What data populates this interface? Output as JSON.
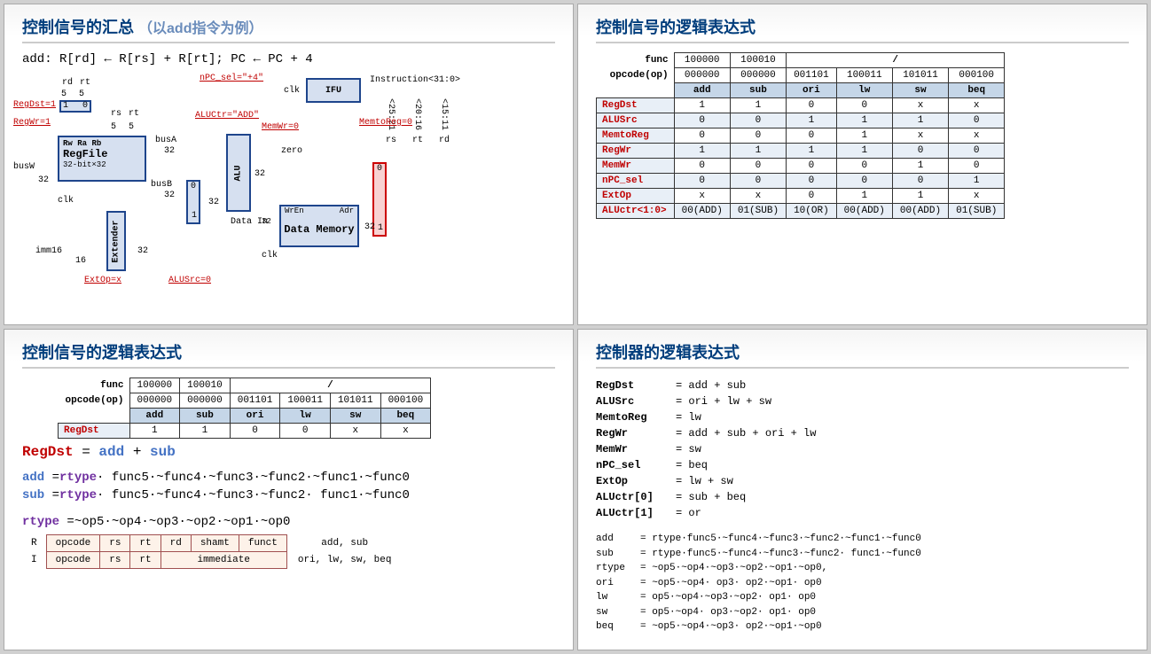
{
  "slides": {
    "tl": {
      "title": "控制信号的汇总",
      "subtitle": "（以add指令为例）",
      "formula": "add: R[rd] ← R[rs] + R[rt]; PC ← PC + 4",
      "diagram": {
        "ifu": "IFU",
        "regfile": "RegFile",
        "regfile_sub": "32-bit×32",
        "alu": "ALU",
        "datamem": "Data Memory",
        "extender": "Extender",
        "instruction": "Instruction<31:0>",
        "rd": "rd",
        "rt": "rt",
        "rs": "rs",
        "rw": "Rw",
        "ra": "Ra",
        "rb": "Rb",
        "clk": "clk",
        "busW": "busW",
        "busA": "busA",
        "busB": "busB",
        "imm16": "imm16",
        "zero": "zero",
        "wren": "WrEn",
        "adr": "Adr",
        "datain": "Data In",
        "regdst": "RegDst=1",
        "regwr": "RegWr=1",
        "npcsel": "nPC_sel=\"+4\"",
        "aluctr": "ALUCtr=\"ADD\"",
        "memwr": "MemWr=0",
        "memtoreg": "MemtoReg=0",
        "extop": "ExtOp=x",
        "alusrc": "ALUSrc=0",
        "n32": "32",
        "n16": "16",
        "n5": "5",
        "m0": "0",
        "m1": "1",
        "sl2521": "<25:21",
        "sl2016": "<20:16",
        "sl1511": "<15:11"
      }
    },
    "tr": {
      "title": "控制信号的逻辑表达式",
      "table": {
        "h_func": "func",
        "h_opcode": "opcode(op)",
        "func_vals": [
          "100000",
          "100010",
          "/",
          "",
          "",
          ""
        ],
        "op_vals": [
          "000000",
          "000000",
          "001101",
          "100011",
          "101011",
          "000100"
        ],
        "cols": [
          "add",
          "sub",
          "ori",
          "lw",
          "sw",
          "beq"
        ],
        "rows": [
          {
            "label": "RegDst",
            "vals": [
              "1",
              "1",
              "0",
              "0",
              "x",
              "x"
            ]
          },
          {
            "label": "ALUSrc",
            "vals": [
              "0",
              "0",
              "1",
              "1",
              "1",
              "0"
            ]
          },
          {
            "label": "MemtoReg",
            "vals": [
              "0",
              "0",
              "0",
              "1",
              "x",
              "x"
            ]
          },
          {
            "label": "RegWr",
            "vals": [
              "1",
              "1",
              "1",
              "1",
              "0",
              "0"
            ]
          },
          {
            "label": "MemWr",
            "vals": [
              "0",
              "0",
              "0",
              "0",
              "1",
              "0"
            ]
          },
          {
            "label": "nPC_sel",
            "vals": [
              "0",
              "0",
              "0",
              "0",
              "0",
              "1"
            ]
          },
          {
            "label": "ExtOp",
            "vals": [
              "x",
              "x",
              "0",
              "1",
              "1",
              "x"
            ]
          },
          {
            "label": "ALUctr<1:0>",
            "vals": [
              "00(ADD)",
              "01(SUB)",
              "10(OR)",
              "00(ADD)",
              "00(ADD)",
              "01(SUB)"
            ]
          }
        ]
      }
    },
    "bl": {
      "title": "控制信号的逻辑表达式",
      "table": {
        "h_func": "func",
        "h_opcode": "opcode(op)",
        "func_vals": [
          "100000",
          "100010",
          "/",
          "",
          "",
          ""
        ],
        "op_vals": [
          "000000",
          "000000",
          "001101",
          "100011",
          "101011",
          "000100"
        ],
        "cols": [
          "add",
          "sub",
          "ori",
          "lw",
          "sw",
          "beq"
        ],
        "row": {
          "label": "RegDst",
          "vals": [
            "1",
            "1",
            "0",
            "0",
            "x",
            "x"
          ]
        }
      },
      "eq1_lhs": "RegDst",
      "eq1_eq": " = ",
      "eq1_a": "add",
      "eq1_plus": " + ",
      "eq1_b": "sub",
      "eq_add_l": "add",
      "eq_add_r": "rtype",
      "eq_add_rest": "· func5·~func4·~func3·~func2·~func1·~func0",
      "eq_sub_l": "sub",
      "eq_sub_r": "rtype",
      "eq_sub_rest": "· func5·~func4·~func3·~func2· func1·~func0",
      "eq_rtype_l": "rtype",
      "eq_rtype_rest": " =~op5·~op4·~op3·~op2·~op1·~op0",
      "rfmt": {
        "r": "R",
        "i": "I",
        "fields": [
          "opcode",
          "rs",
          "rt",
          "rd",
          "shamt",
          "funct"
        ],
        "ifields": [
          "opcode",
          "rs",
          "rt",
          "immediate"
        ],
        "rnote": "add, sub",
        "inote": "ori, lw, sw, beq"
      }
    },
    "br": {
      "title": "控制器的逻辑表达式",
      "eqs": [
        {
          "lhs": "RegDst",
          "rhs": "= add + sub"
        },
        {
          "lhs": "ALUSrc",
          "rhs": "= ori + lw + sw"
        },
        {
          "lhs": "MemtoReg",
          "rhs": "= lw"
        },
        {
          "lhs": "RegWr",
          "rhs": "= add + sub + ori + lw"
        },
        {
          "lhs": "MemWr",
          "rhs": "= sw"
        },
        {
          "lhs": "nPC_sel",
          "rhs": "= beq"
        },
        {
          "lhs": "ExtOp",
          "rhs": "= lw + sw"
        },
        {
          "lhs": "ALUctr[0]",
          "rhs": "= sub + beq"
        },
        {
          "lhs": "ALUctr[1]",
          "rhs": "= or"
        }
      ],
      "defs": [
        {
          "lhs": "add",
          "rhs": "= rtype·func5·~func4·~func3·~func2·~func1·~func0"
        },
        {
          "lhs": "sub",
          "rhs": "= rtype·func5·~func4·~func3·~func2· func1·~func0"
        },
        {
          "lhs": "rtype",
          "rhs": "= ~op5·~op4·~op3·~op2·~op1·~op0,"
        },
        {
          "lhs": "ori",
          "rhs": "= ~op5·~op4· op3· op2·~op1· op0"
        },
        {
          "lhs": "lw",
          "rhs": "=  op5·~op4·~op3·~op2· op1· op0"
        },
        {
          "lhs": "sw",
          "rhs": "=  op5·~op4· op3·~op2· op1· op0"
        },
        {
          "lhs": "beq",
          "rhs": "= ~op5·~op4·~op3· op2·~op1·~op0"
        }
      ]
    }
  }
}
